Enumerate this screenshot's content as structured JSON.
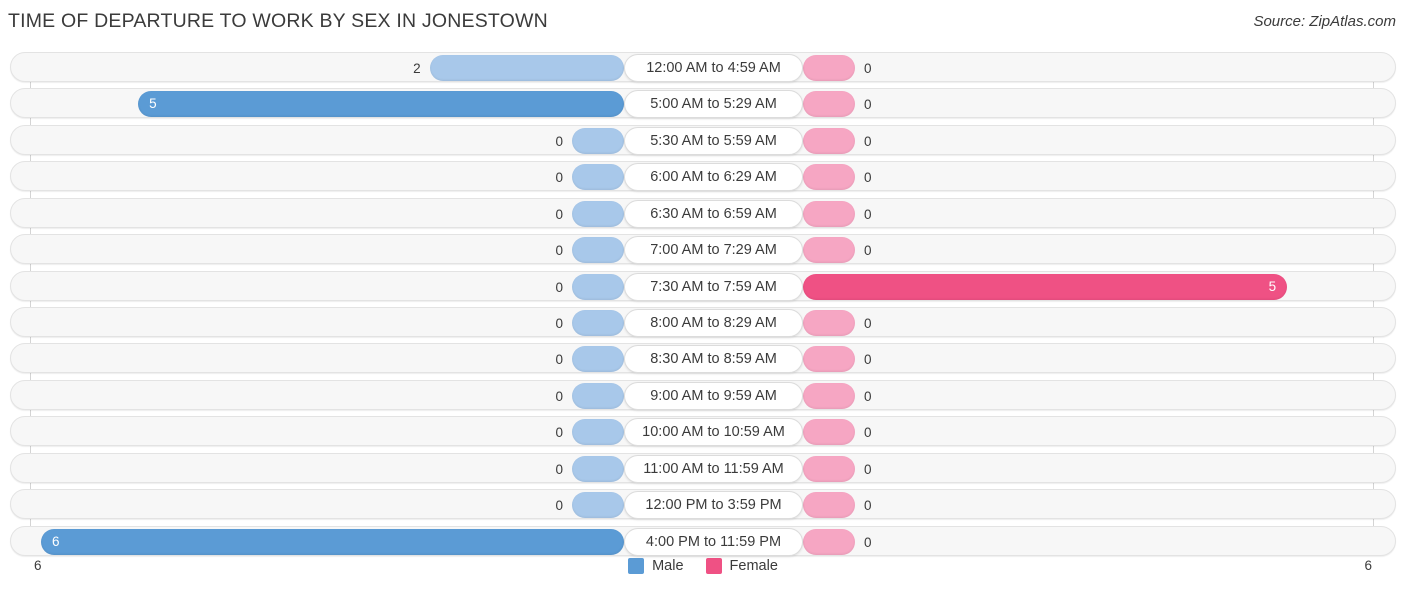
{
  "header": {
    "title": "TIME OF DEPARTURE TO WORK BY SEX IN JONESTOWN",
    "source": "Source: ZipAtlas.com"
  },
  "legend": {
    "male": {
      "label": "Male",
      "color": "#5b9bd5"
    },
    "female": {
      "label": "Female",
      "color": "#ef5184"
    }
  },
  "axis": {
    "left_tick": "6",
    "right_tick": "6"
  },
  "colors": {
    "male_strong": "#5b9bd5",
    "male_light": "#a8c8ea",
    "female_strong": "#ef5184",
    "female_light": "#f6a6c3",
    "row_bg": "#f7f7f7",
    "row_border": "#e3e3e3",
    "text": "#3b3b3b"
  },
  "chart_data": {
    "type": "bar",
    "title": "TIME OF DEPARTURE TO WORK BY SEX IN JONESTOWN",
    "xlabel": "",
    "ylabel": "",
    "orientation": "horizontal-diverging",
    "axis_max": 6,
    "xlim": [
      0,
      6
    ],
    "grid": false,
    "legend_position": "bottom-center",
    "categories": [
      "12:00 AM to 4:59 AM",
      "5:00 AM to 5:29 AM",
      "5:30 AM to 5:59 AM",
      "6:00 AM to 6:29 AM",
      "6:30 AM to 6:59 AM",
      "7:00 AM to 7:29 AM",
      "7:30 AM to 7:59 AM",
      "8:00 AM to 8:29 AM",
      "8:30 AM to 8:59 AM",
      "9:00 AM to 9:59 AM",
      "10:00 AM to 10:59 AM",
      "11:00 AM to 11:59 AM",
      "12:00 PM to 3:59 PM",
      "4:00 PM to 11:59 PM"
    ],
    "series": [
      {
        "name": "Male",
        "values": [
          2,
          5,
          0,
          0,
          0,
          0,
          0,
          0,
          0,
          0,
          0,
          0,
          0,
          6
        ]
      },
      {
        "name": "Female",
        "values": [
          0,
          0,
          0,
          0,
          0,
          0,
          5,
          0,
          0,
          0,
          0,
          0,
          0,
          0
        ]
      }
    ]
  },
  "rows": [
    {
      "label": "12:00 AM to 4:59 AM",
      "male": "2",
      "female": "0"
    },
    {
      "label": "5:00 AM to 5:29 AM",
      "male": "5",
      "female": "0"
    },
    {
      "label": "5:30 AM to 5:59 AM",
      "male": "0",
      "female": "0"
    },
    {
      "label": "6:00 AM to 6:29 AM",
      "male": "0",
      "female": "0"
    },
    {
      "label": "6:30 AM to 6:59 AM",
      "male": "0",
      "female": "0"
    },
    {
      "label": "7:00 AM to 7:29 AM",
      "male": "0",
      "female": "0"
    },
    {
      "label": "7:30 AM to 7:59 AM",
      "male": "0",
      "female": "5"
    },
    {
      "label": "8:00 AM to 8:29 AM",
      "male": "0",
      "female": "0"
    },
    {
      "label": "8:30 AM to 8:59 AM",
      "male": "0",
      "female": "0"
    },
    {
      "label": "9:00 AM to 9:59 AM",
      "male": "0",
      "female": "0"
    },
    {
      "label": "10:00 AM to 10:59 AM",
      "male": "0",
      "female": "0"
    },
    {
      "label": "11:00 AM to 11:59 AM",
      "male": "0",
      "female": "0"
    },
    {
      "label": "12:00 PM to 3:59 PM",
      "male": "0",
      "female": "0"
    },
    {
      "label": "4:00 PM to 11:59 PM",
      "male": "6",
      "female": "0"
    }
  ]
}
